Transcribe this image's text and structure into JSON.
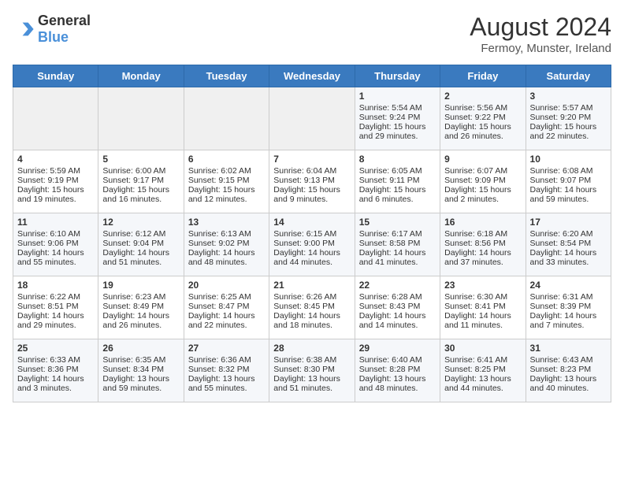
{
  "header": {
    "logo_general": "General",
    "logo_blue": "Blue",
    "month_year": "August 2024",
    "location": "Fermoy, Munster, Ireland"
  },
  "days_of_week": [
    "Sunday",
    "Monday",
    "Tuesday",
    "Wednesday",
    "Thursday",
    "Friday",
    "Saturday"
  ],
  "weeks": [
    [
      {
        "day": "",
        "content": ""
      },
      {
        "day": "",
        "content": ""
      },
      {
        "day": "",
        "content": ""
      },
      {
        "day": "",
        "content": ""
      },
      {
        "day": "1",
        "content": "Sunrise: 5:54 AM\nSunset: 9:24 PM\nDaylight: 15 hours and 29 minutes."
      },
      {
        "day": "2",
        "content": "Sunrise: 5:56 AM\nSunset: 9:22 PM\nDaylight: 15 hours and 26 minutes."
      },
      {
        "day": "3",
        "content": "Sunrise: 5:57 AM\nSunset: 9:20 PM\nDaylight: 15 hours and 22 minutes."
      }
    ],
    [
      {
        "day": "4",
        "content": "Sunrise: 5:59 AM\nSunset: 9:19 PM\nDaylight: 15 hours and 19 minutes."
      },
      {
        "day": "5",
        "content": "Sunrise: 6:00 AM\nSunset: 9:17 PM\nDaylight: 15 hours and 16 minutes."
      },
      {
        "day": "6",
        "content": "Sunrise: 6:02 AM\nSunset: 9:15 PM\nDaylight: 15 hours and 12 minutes."
      },
      {
        "day": "7",
        "content": "Sunrise: 6:04 AM\nSunset: 9:13 PM\nDaylight: 15 hours and 9 minutes."
      },
      {
        "day": "8",
        "content": "Sunrise: 6:05 AM\nSunset: 9:11 PM\nDaylight: 15 hours and 6 minutes."
      },
      {
        "day": "9",
        "content": "Sunrise: 6:07 AM\nSunset: 9:09 PM\nDaylight: 15 hours and 2 minutes."
      },
      {
        "day": "10",
        "content": "Sunrise: 6:08 AM\nSunset: 9:07 PM\nDaylight: 14 hours and 59 minutes."
      }
    ],
    [
      {
        "day": "11",
        "content": "Sunrise: 6:10 AM\nSunset: 9:06 PM\nDaylight: 14 hours and 55 minutes."
      },
      {
        "day": "12",
        "content": "Sunrise: 6:12 AM\nSunset: 9:04 PM\nDaylight: 14 hours and 51 minutes."
      },
      {
        "day": "13",
        "content": "Sunrise: 6:13 AM\nSunset: 9:02 PM\nDaylight: 14 hours and 48 minutes."
      },
      {
        "day": "14",
        "content": "Sunrise: 6:15 AM\nSunset: 9:00 PM\nDaylight: 14 hours and 44 minutes."
      },
      {
        "day": "15",
        "content": "Sunrise: 6:17 AM\nSunset: 8:58 PM\nDaylight: 14 hours and 41 minutes."
      },
      {
        "day": "16",
        "content": "Sunrise: 6:18 AM\nSunset: 8:56 PM\nDaylight: 14 hours and 37 minutes."
      },
      {
        "day": "17",
        "content": "Sunrise: 6:20 AM\nSunset: 8:54 PM\nDaylight: 14 hours and 33 minutes."
      }
    ],
    [
      {
        "day": "18",
        "content": "Sunrise: 6:22 AM\nSunset: 8:51 PM\nDaylight: 14 hours and 29 minutes."
      },
      {
        "day": "19",
        "content": "Sunrise: 6:23 AM\nSunset: 8:49 PM\nDaylight: 14 hours and 26 minutes."
      },
      {
        "day": "20",
        "content": "Sunrise: 6:25 AM\nSunset: 8:47 PM\nDaylight: 14 hours and 22 minutes."
      },
      {
        "day": "21",
        "content": "Sunrise: 6:26 AM\nSunset: 8:45 PM\nDaylight: 14 hours and 18 minutes."
      },
      {
        "day": "22",
        "content": "Sunrise: 6:28 AM\nSunset: 8:43 PM\nDaylight: 14 hours and 14 minutes."
      },
      {
        "day": "23",
        "content": "Sunrise: 6:30 AM\nSunset: 8:41 PM\nDaylight: 14 hours and 11 minutes."
      },
      {
        "day": "24",
        "content": "Sunrise: 6:31 AM\nSunset: 8:39 PM\nDaylight: 14 hours and 7 minutes."
      }
    ],
    [
      {
        "day": "25",
        "content": "Sunrise: 6:33 AM\nSunset: 8:36 PM\nDaylight: 14 hours and 3 minutes."
      },
      {
        "day": "26",
        "content": "Sunrise: 6:35 AM\nSunset: 8:34 PM\nDaylight: 13 hours and 59 minutes."
      },
      {
        "day": "27",
        "content": "Sunrise: 6:36 AM\nSunset: 8:32 PM\nDaylight: 13 hours and 55 minutes."
      },
      {
        "day": "28",
        "content": "Sunrise: 6:38 AM\nSunset: 8:30 PM\nDaylight: 13 hours and 51 minutes."
      },
      {
        "day": "29",
        "content": "Sunrise: 6:40 AM\nSunset: 8:28 PM\nDaylight: 13 hours and 48 minutes."
      },
      {
        "day": "30",
        "content": "Sunrise: 6:41 AM\nSunset: 8:25 PM\nDaylight: 13 hours and 44 minutes."
      },
      {
        "day": "31",
        "content": "Sunrise: 6:43 AM\nSunset: 8:23 PM\nDaylight: 13 hours and 40 minutes."
      }
    ]
  ]
}
